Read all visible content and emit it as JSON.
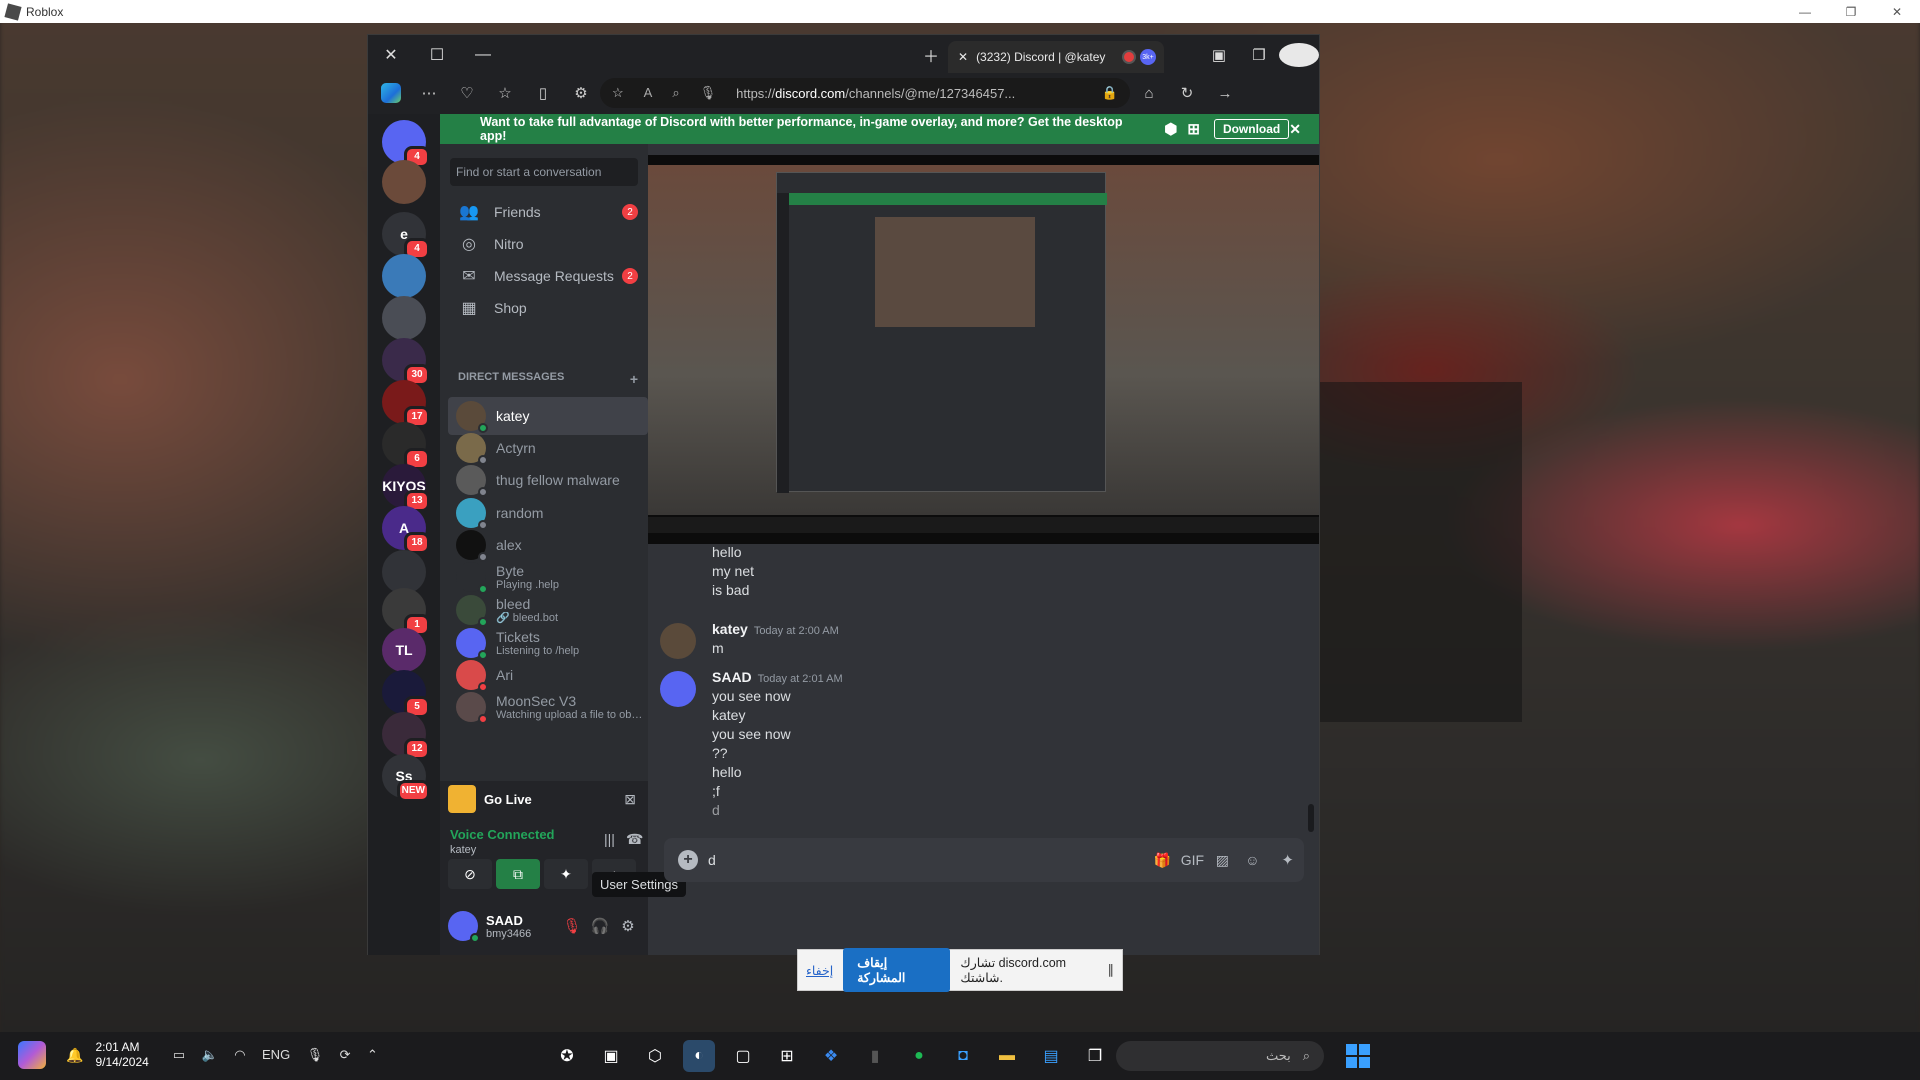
{
  "window": {
    "title": "Roblox"
  },
  "browser": {
    "tab_title": "(3232) Discord | @katey",
    "tab_badge": "3k+",
    "url_domain": "discord.com",
    "url_prefix": "https://",
    "url_rest": "/channels/@me/127346457..."
  },
  "banner": {
    "text": "Want to take full advantage of Discord with better performance, in-game overlay, and more? Get the desktop app!",
    "download_label": "Download"
  },
  "guilds": [
    {
      "label": "",
      "badge": "4",
      "color": "#5865f2"
    },
    {
      "label": "",
      "badge": "",
      "color": "#6b4a3a"
    },
    {
      "label": "e",
      "badge": "4",
      "color": "#313338"
    },
    {
      "label": "",
      "badge": "",
      "color": "#3a7ab8"
    },
    {
      "label": "",
      "badge": "",
      "color": "#4a4d55"
    },
    {
      "label": "",
      "badge": "30",
      "color": "#3a2a4a"
    },
    {
      "label": "",
      "badge": "17",
      "color": "#7a1a1a"
    },
    {
      "label": "",
      "badge": "6",
      "color": "#2a2a2a"
    },
    {
      "label": "KIYOS",
      "badge": "13",
      "color": "#2a1a3a"
    },
    {
      "label": "A",
      "badge": "18",
      "color": "#4a2a8a"
    },
    {
      "label": "",
      "badge": "",
      "color": "#313338"
    },
    {
      "label": "",
      "badge": "1",
      "color": "#3a3a3a"
    },
    {
      "label": "TL",
      "badge": "",
      "color": "#5a2a6a"
    },
    {
      "label": "",
      "badge": "5",
      "color": "#1a1a3a"
    },
    {
      "label": "",
      "badge": "12",
      "color": "#3a2a3a"
    },
    {
      "label": "Ss",
      "badge": "NEW",
      "color": "#313338"
    }
  ],
  "search": {
    "placeholder": "Find or start a conversation"
  },
  "nav": [
    {
      "label": "Friends",
      "badge": "2",
      "icon": "friends-icon"
    },
    {
      "label": "Nitro",
      "badge": "",
      "icon": "nitro-icon"
    },
    {
      "label": "Message Requests",
      "badge": "2",
      "icon": "mail-icon"
    },
    {
      "label": "Shop",
      "badge": "",
      "icon": "shop-icon"
    }
  ],
  "dm_header": "DIRECT MESSAGES",
  "dms": [
    {
      "name": "katey",
      "sub": "",
      "status": "#23a55a",
      "av": "#5a4a3a"
    },
    {
      "name": "Actyrn",
      "sub": "",
      "status": "#80848e",
      "av": "#7a6a4a"
    },
    {
      "name": "thug fellow malware",
      "sub": "",
      "status": "#80848e",
      "av": "#5a5a5a"
    },
    {
      "name": "random",
      "sub": "",
      "status": "#80848e",
      "av": "#3aa0c0"
    },
    {
      "name": "alex",
      "sub": "",
      "status": "#80848e",
      "av": "#111111"
    },
    {
      "name": "Byte",
      "sub": "Playing .help",
      "status": "#23a55a",
      "av": "#2b2d31"
    },
    {
      "name": "bleed",
      "sub": "🔗 bleed.bot",
      "status": "#23a55a",
      "av": "#3a4a3a"
    },
    {
      "name": "Tickets",
      "sub": "Listening to /help",
      "status": "#23a55a",
      "av": "#5865f2"
    },
    {
      "name": "Ari",
      "sub": "",
      "status": "#f23f43",
      "av": "#d94a4a"
    },
    {
      "name": "MoonSec V3",
      "sub": "Watching upload a file to obfu...",
      "status": "#f23f43",
      "av": "#5a4a4a"
    }
  ],
  "golive": {
    "label": "Go Live"
  },
  "voice": {
    "status": "Voice Connected",
    "channel": "katey"
  },
  "user": {
    "name": "SAAD",
    "handle": "bmy3466"
  },
  "tooltip": "User Settings",
  "messages": [
    {
      "text": "hello"
    },
    {
      "text": "my net"
    },
    {
      "text": "is bad"
    }
  ],
  "groups": [
    {
      "author": "katey",
      "time": "Today at 2:00 AM",
      "lines": [
        "m"
      ]
    },
    {
      "author": "SAAD",
      "time": "Today at 2:01 AM",
      "lines": [
        "you see now",
        "katey",
        "you see now",
        "??",
        "hello",
        ";f",
        "d"
      ]
    }
  ],
  "composer": {
    "text": "d"
  },
  "sharebar": {
    "text": "تشارك discord.com شاشتك.",
    "stop_label": "إيقاف المشاركة",
    "hide_label": "إخفاء"
  },
  "taskbar": {
    "time": "2:01 AM",
    "date": "9/14/2024",
    "lang": "ENG",
    "search_placeholder": "بحث"
  }
}
